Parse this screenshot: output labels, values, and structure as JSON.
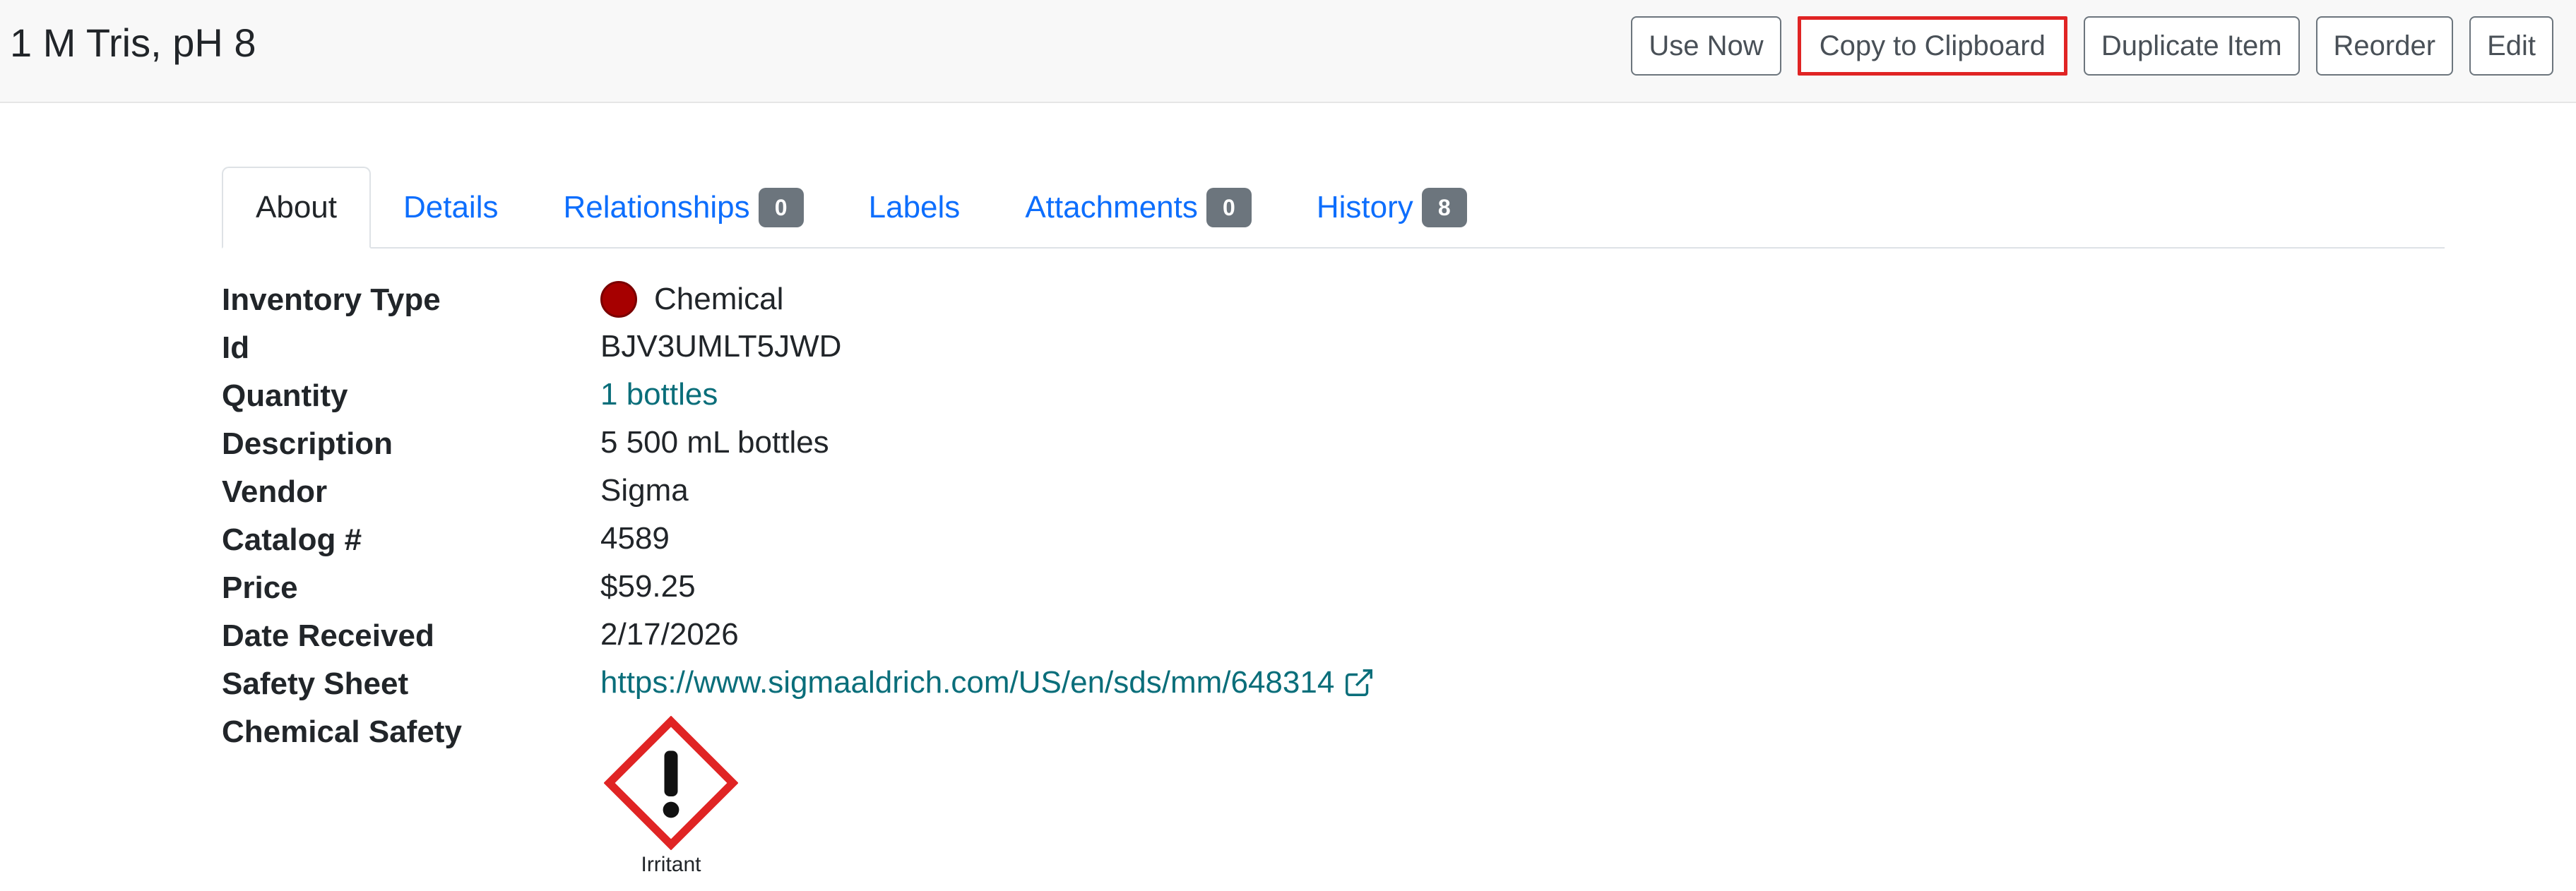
{
  "header": {
    "title": "1 M Tris, pH 8",
    "buttons": {
      "use_now": "Use Now",
      "copy_to_clipboard": "Copy to Clipboard",
      "duplicate_item": "Duplicate Item",
      "reorder": "Reorder",
      "edit": "Edit"
    }
  },
  "tabs": [
    {
      "label": "About",
      "active": true
    },
    {
      "label": "Details"
    },
    {
      "label": "Relationships",
      "badge": "0"
    },
    {
      "label": "Labels"
    },
    {
      "label": "Attachments",
      "badge": "0"
    },
    {
      "label": "History",
      "badge": "8"
    }
  ],
  "fields": {
    "inventory_type": {
      "label": "Inventory Type",
      "value": "Chemical",
      "color": "#a60000"
    },
    "id": {
      "label": "Id",
      "value": "BJV3UMLT5JWD"
    },
    "quantity": {
      "label": "Quantity",
      "value": "1 bottles"
    },
    "description": {
      "label": "Description",
      "value": "5 500 mL bottles"
    },
    "vendor": {
      "label": "Vendor",
      "value": "Sigma"
    },
    "catalog": {
      "label": "Catalog #",
      "value": "4589"
    },
    "price": {
      "label": "Price",
      "value": "$59.25"
    },
    "date_received": {
      "label": "Date Received",
      "value": "2/17/2026"
    },
    "safety_sheet": {
      "label": "Safety Sheet",
      "value": "https://www.sigmaaldrich.com/US/en/sds/mm/648314",
      "icon": "external-link-icon"
    },
    "chemical_safety": {
      "label": "Chemical Safety",
      "pictogram": "exclamation-mark-hazard-icon",
      "caption": "Irritant"
    }
  },
  "colors": {
    "link": "#0a6e7a",
    "tab_link": "#0d6efd",
    "badge": "#6c757d",
    "highlight": "#e02424",
    "hazard_red": "#e02424"
  }
}
